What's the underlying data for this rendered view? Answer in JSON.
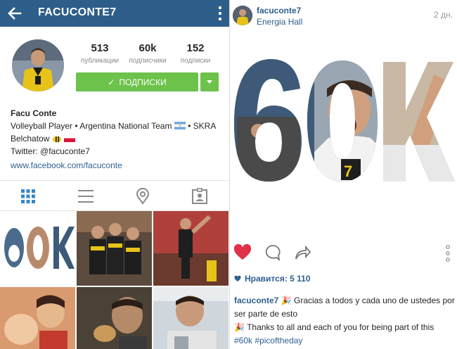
{
  "profile": {
    "username": "FACUCONTE7",
    "stats": [
      {
        "value": "513",
        "label": "публикации"
      },
      {
        "value": "60k",
        "label": "подписчики"
      },
      {
        "value": "152",
        "label": "подписки"
      }
    ],
    "follow_label": "ПОДПИСКИ",
    "bio": {
      "name": "Facu Conte",
      "line1": "Volleyball Player • Argentina National Team",
      "line1b": "• SKRA",
      "line2": "Belchatow",
      "twitter": "Twitter: @facuconte7",
      "link": "www.facebook.com/facuconte"
    },
    "tabs": [
      "grid-icon",
      "list-icon",
      "location-pin-icon",
      "tagged-person-icon"
    ]
  },
  "post": {
    "username": "facuconte7",
    "location": "Energia Hall",
    "time": "2 дн.",
    "image_text": "60K",
    "likes": "Нравится: 5 110",
    "caption": {
      "user": "facuconte7",
      "text1": "Gracias a todos y cada uno de ustedes por ser parte de esto",
      "text2": "Thanks to all and each of you for being part of this",
      "tags": [
        "#60k",
        "#picoftheday"
      ]
    }
  },
  "colors": {
    "appbar": "#2d5e8a",
    "follow_green": "#6cc24a",
    "link_blue": "#2f5f8f",
    "like_red": "#e0304a"
  }
}
